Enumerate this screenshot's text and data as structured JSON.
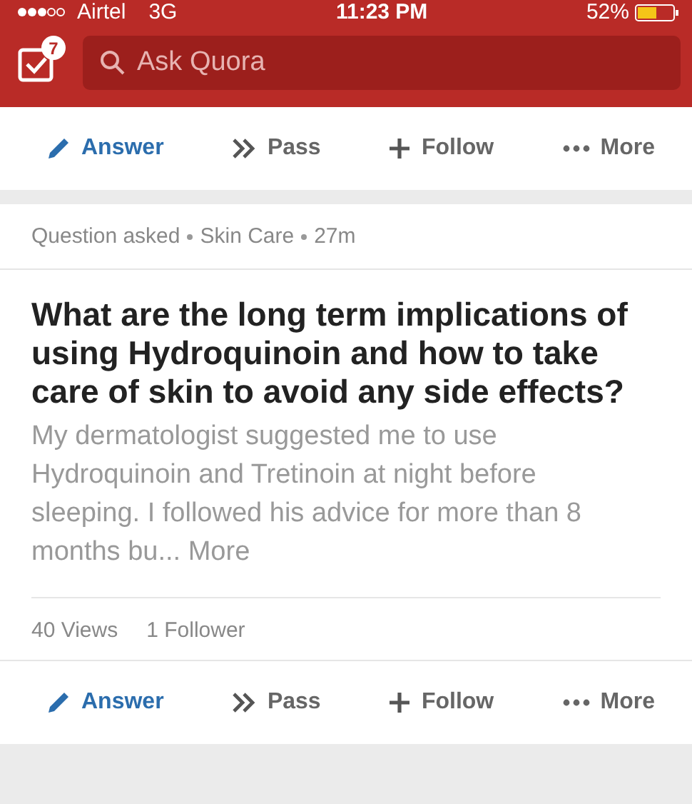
{
  "status_bar": {
    "carrier": "Airtel",
    "network": "3G",
    "time": "11:23 PM",
    "battery": "52%"
  },
  "header": {
    "notification_count": "7",
    "search": {
      "placeholder": "Ask Quora"
    }
  },
  "top_actions": [
    {
      "kind": "answer",
      "label": "Answer"
    },
    {
      "kind": "pass",
      "label": "Pass"
    },
    {
      "kind": "follow",
      "label": "Follow"
    },
    {
      "kind": "more",
      "label": "More"
    }
  ],
  "question_card": {
    "meta": [
      "Question asked",
      "Skin Care",
      "27m"
    ],
    "title": "What are the long term implications of using Hydroquinoin and how to take care of skin to avoid any side effects?",
    "body": "My dermatologist suggested me to use Hydroquinoin and Tretinoin at night before sleeping. I followed his advice for more than 8 months bu...",
    "more_link": "More",
    "stats": [
      "40 Views",
      "1 Follower"
    ],
    "actions": [
      {
        "kind": "answer",
        "label": "Answer"
      },
      {
        "kind": "pass",
        "label": "Pass"
      },
      {
        "kind": "follow",
        "label": "Follow"
      },
      {
        "kind": "more",
        "label": "More"
      }
    ]
  }
}
